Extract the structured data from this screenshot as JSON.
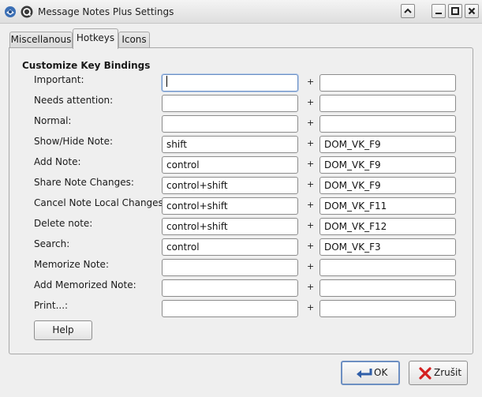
{
  "window": {
    "title": "Message Notes Plus Settings"
  },
  "tabs": [
    {
      "label": "Miscellanous"
    },
    {
      "label": "Hotkeys"
    },
    {
      "label": "Icons"
    }
  ],
  "section": {
    "title": "Customize Key Bindings"
  },
  "separator": "+",
  "bindings": [
    {
      "label": "Important:",
      "modifier": "",
      "key": ""
    },
    {
      "label": "Needs attention:",
      "modifier": "",
      "key": ""
    },
    {
      "label": "Normal:",
      "modifier": "",
      "key": ""
    },
    {
      "label": "Show/Hide Note:",
      "modifier": "shift",
      "key": "DOM_VK_F9"
    },
    {
      "label": "Add Note:",
      "modifier": "control",
      "key": "DOM_VK_F9"
    },
    {
      "label": "Share Note Changes:",
      "modifier": "control+shift",
      "key": "DOM_VK_F9"
    },
    {
      "label": "Cancel Note Local Changes:",
      "modifier": "control+shift",
      "key": "DOM_VK_F11"
    },
    {
      "label": "Delete note:",
      "modifier": "control+shift",
      "key": "DOM_VK_F12"
    },
    {
      "label": "Search:",
      "modifier": "control",
      "key": "DOM_VK_F3"
    },
    {
      "label": "Memorize Note:",
      "modifier": "",
      "key": ""
    },
    {
      "label": "Add Memorized Note:",
      "modifier": "",
      "key": ""
    },
    {
      "label": "Print...:",
      "modifier": "",
      "key": ""
    }
  ],
  "buttons": {
    "help": "Help",
    "ok": "OK",
    "cancel": "Zrušit"
  }
}
